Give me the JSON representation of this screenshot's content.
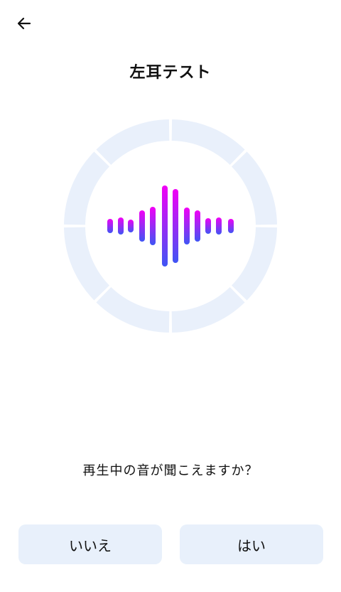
{
  "header": {
    "back_icon": "arrow-left-icon",
    "title": "左耳テスト"
  },
  "visual": {
    "ring_icon": "progress-ring",
    "waveform_icon": "sound-waveform-icon",
    "ring_color": "#e9f0fb",
    "waveform_gradient": [
      "#f200f5",
      "#3f55f4"
    ]
  },
  "prompt": {
    "question": "再生中の音が聞こえますか？"
  },
  "actions": {
    "no_label": "いいえ",
    "yes_label": "はい"
  }
}
